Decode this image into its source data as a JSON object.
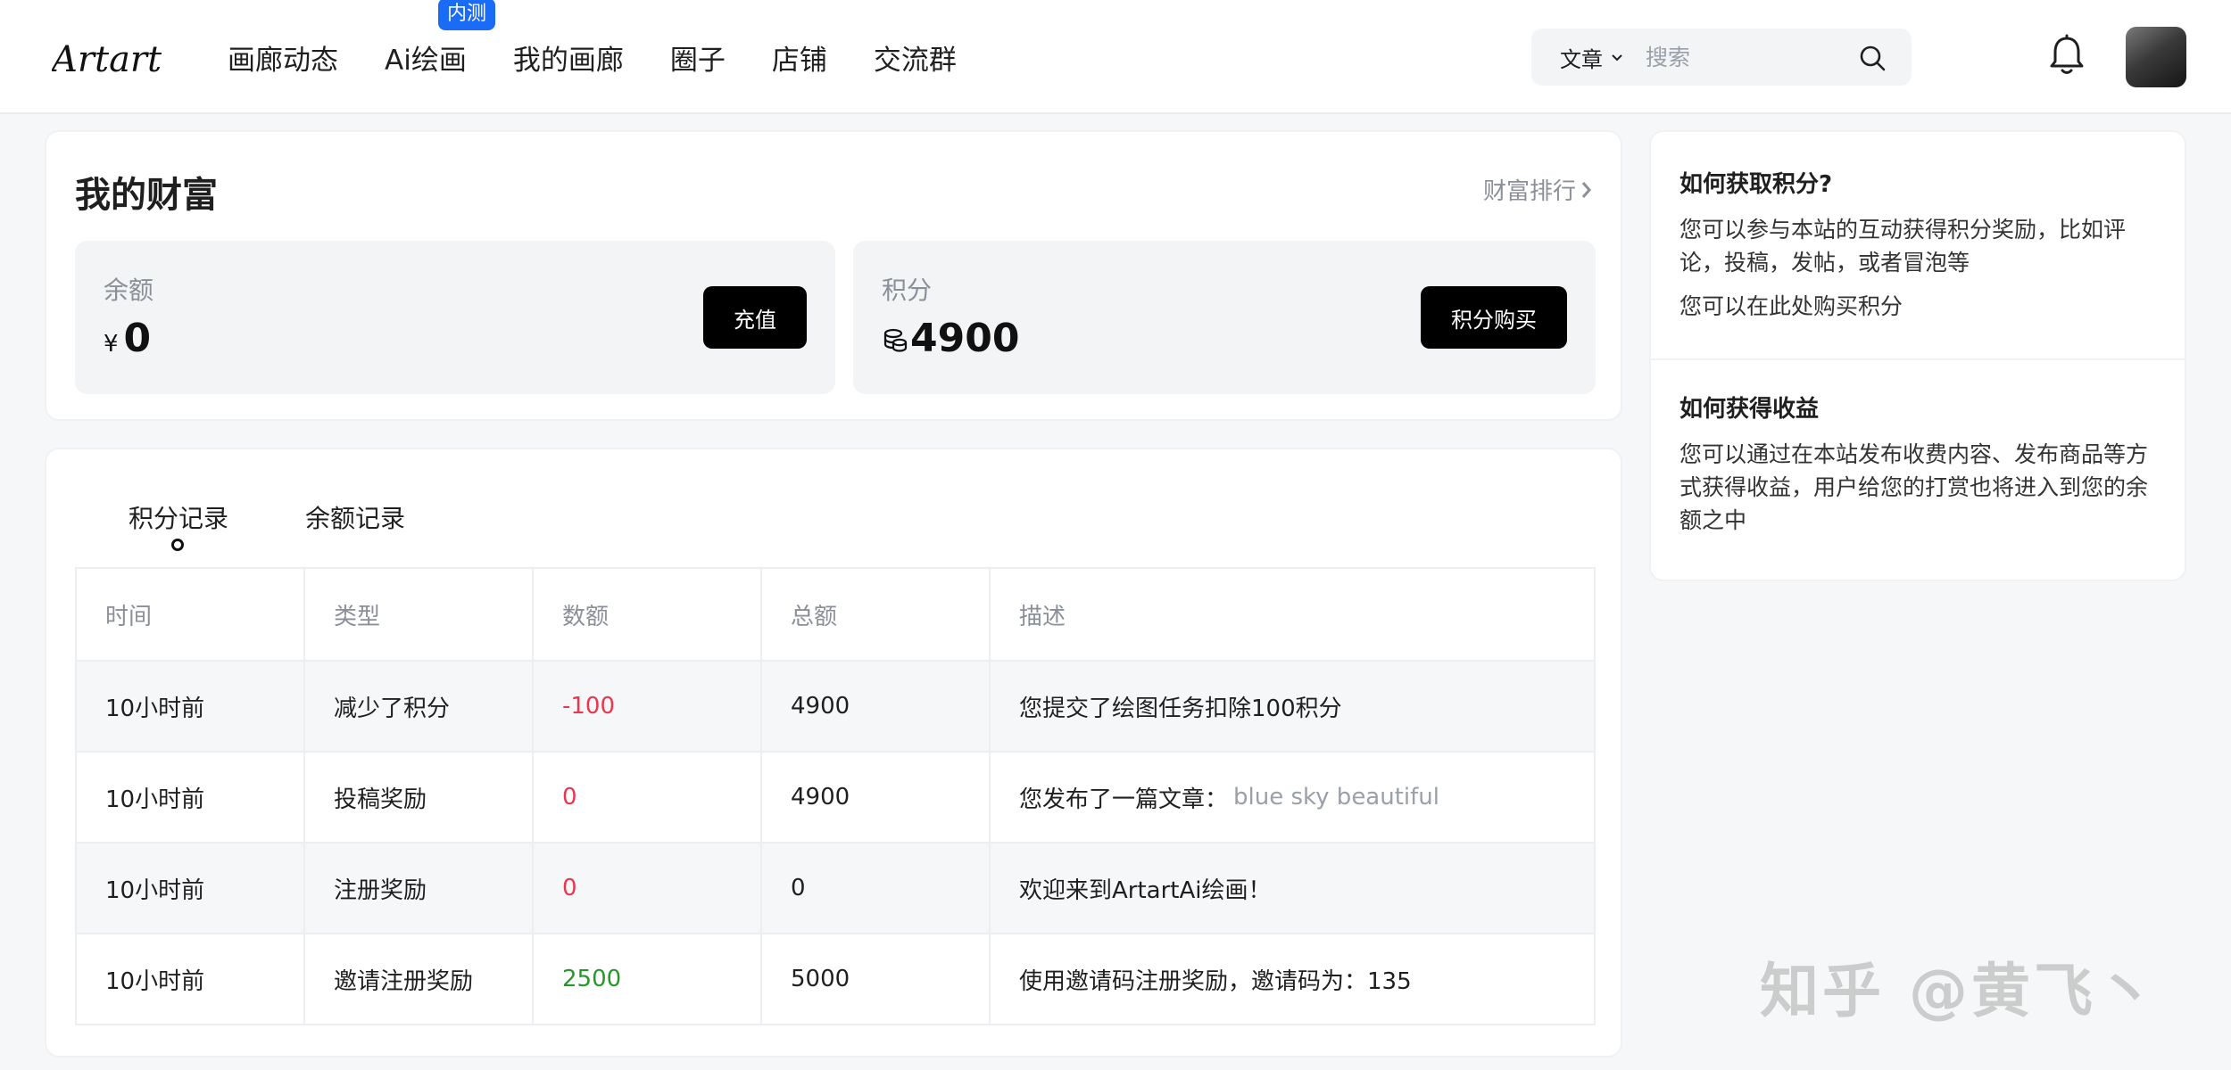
{
  "header": {
    "logo_text": "Artart",
    "nav": [
      {
        "label": "画廊动态"
      },
      {
        "label": "Ai绘画",
        "badge": "内测"
      },
      {
        "label": "我的画廊"
      },
      {
        "label": "圈子"
      },
      {
        "label": "店铺"
      },
      {
        "label": "交流群"
      }
    ],
    "search": {
      "type": "文章",
      "placeholder": "搜索"
    }
  },
  "wealth": {
    "title": "我的财富",
    "rank_link": "财富排行",
    "balance": {
      "label": "余额",
      "currency": "¥",
      "value": "0",
      "button": "充值"
    },
    "points": {
      "label": "积分",
      "value": "4900",
      "button": "积分购买"
    }
  },
  "records": {
    "tabs": [
      {
        "label": "积分记录",
        "active": true
      },
      {
        "label": "余额记录"
      }
    ],
    "columns": [
      "时间",
      "类型",
      "数额",
      "总额",
      "描述"
    ],
    "rows": [
      {
        "time": "10小时前",
        "type": "减少了积分",
        "amount": "-100",
        "total": "4900",
        "desc": "您提交了绘图任务扣除100积分",
        "desc_link": ""
      },
      {
        "time": "10小时前",
        "type": "投稿奖励",
        "amount": "0",
        "total": "4900",
        "desc": "您发布了一篇文章：",
        "desc_link": "blue sky beautiful"
      },
      {
        "time": "10小时前",
        "type": "注册奖励",
        "amount": "0",
        "total": "0",
        "desc": "欢迎来到ArtartAi绘画！",
        "desc_link": ""
      },
      {
        "time": "10小时前",
        "type": "邀请注册奖励",
        "amount": "2500",
        "total": "5000",
        "desc": "使用邀请码注册奖励，邀请码为：135",
        "desc_link": ""
      }
    ]
  },
  "help": {
    "points": {
      "title": "如何获取积分?",
      "text1": "您可以参与本站的互动获得积分奖励，比如评论，投稿，发帖，或者冒泡等",
      "text2": "您可以在此处购买积分"
    },
    "earnings": {
      "title": "如何获得收益",
      "text": "您可以通过在本站发布收费内容、发布商品等方式获得收益，用户给您的打赏也将进入到您的余额之中"
    }
  },
  "watermark": "知乎 @黄飞丶",
  "colors": {
    "badge": "#1a6cf6",
    "negative": "#e8384f",
    "positive": "#26982a",
    "button": "#000000"
  }
}
